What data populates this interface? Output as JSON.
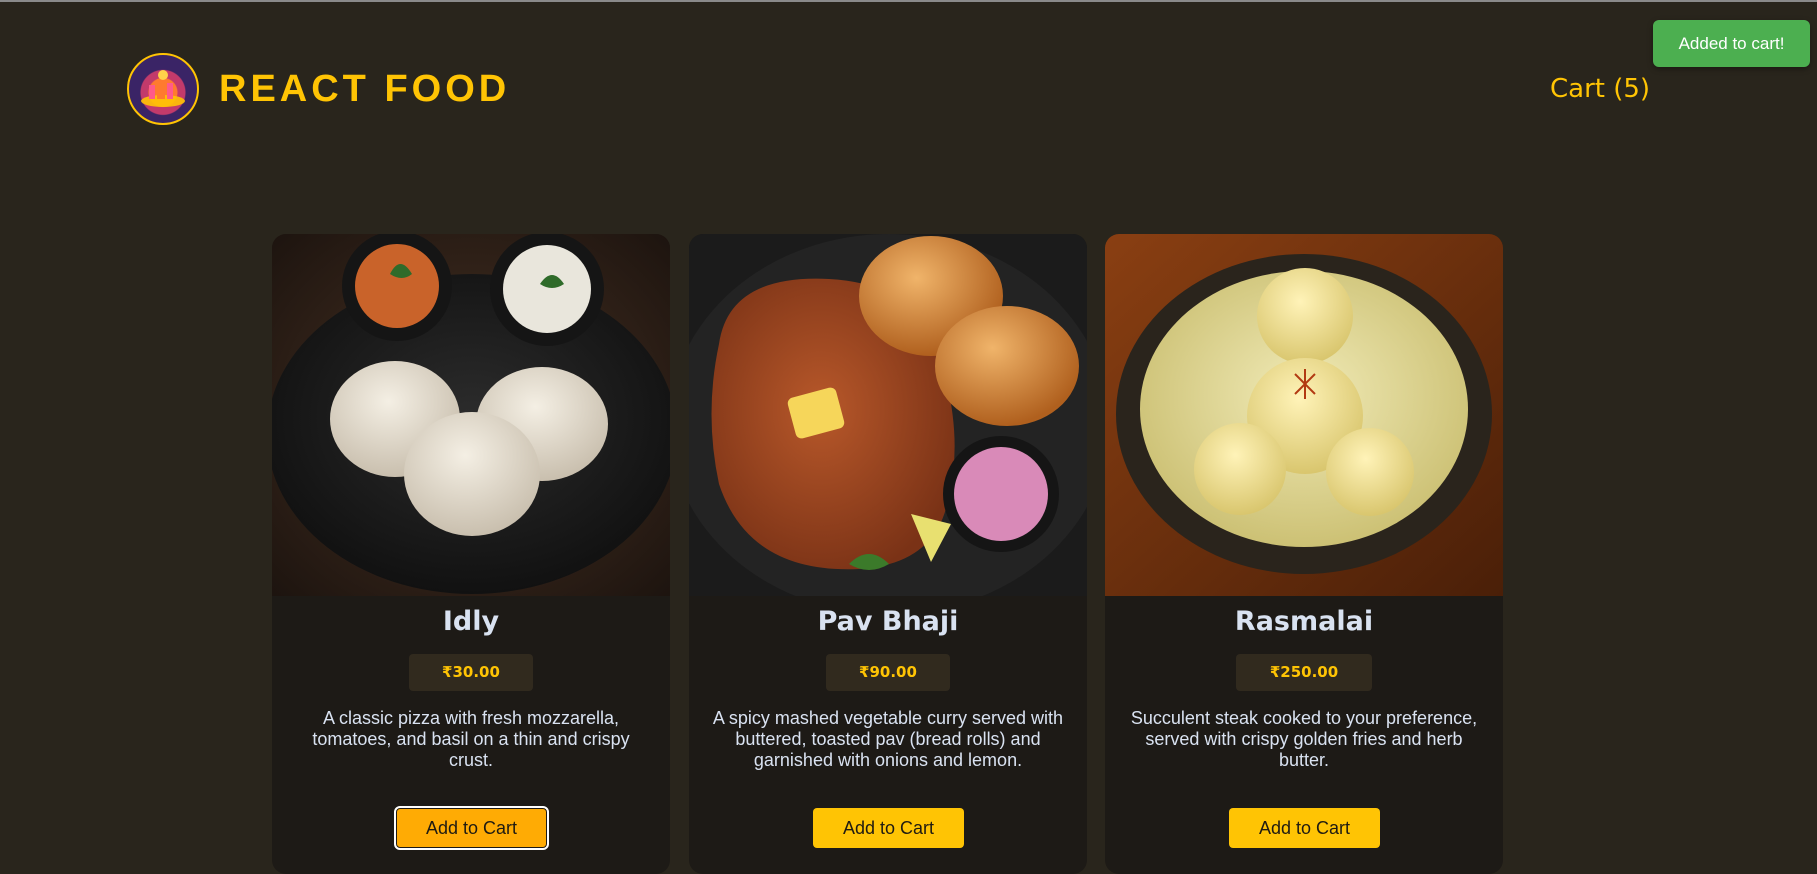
{
  "header": {
    "brand": "REACT FOOD",
    "cart_label": "Cart (5)",
    "logo_icon": "react-food-logo-icon",
    "accent_color": "#ffc404"
  },
  "toast": {
    "message": "Added to cart!",
    "color": "#4caf50"
  },
  "meals": [
    {
      "name": "Idly",
      "price": "₹30.00",
      "description": "A classic pizza with fresh mozzarella, tomatoes, and basil on a thin and crispy crust.",
      "button_label": "Add to Cart"
    },
    {
      "name": "Pav Bhaji",
      "price": "₹90.00",
      "description": "A spicy mashed vegetable curry served with buttered, toasted pav (bread rolls) and garnished with onions and lemon.",
      "button_label": "Add to Cart"
    },
    {
      "name": "Rasmalai",
      "price": "₹250.00",
      "description": "Succulent steak cooked to your preference, served with crispy golden fries and herb butter.",
      "button_label": "Add to Cart"
    }
  ]
}
